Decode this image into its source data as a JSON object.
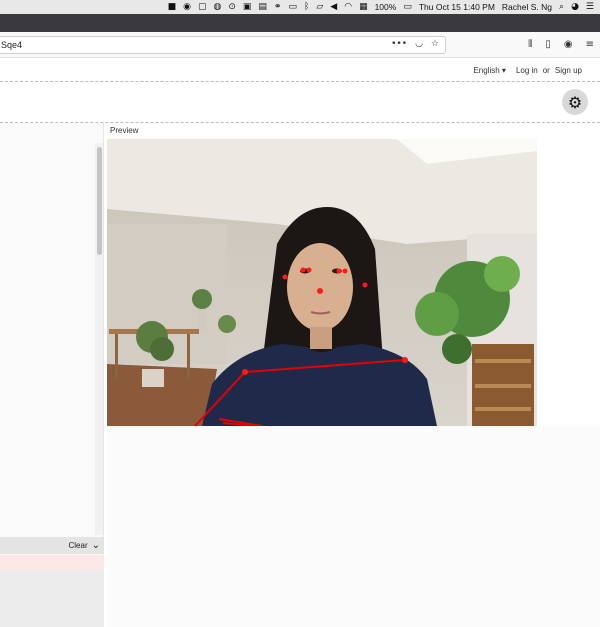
{
  "menubar": {
    "battery": "100%",
    "datetime": "Thu Oct 15  1:40 PM",
    "user": "Rachel S. Ng"
  },
  "browser": {
    "url": "Sqe4"
  },
  "auth": {
    "language": "English",
    "login": "Log in",
    "or": "or",
    "signup": "Sign up"
  },
  "preview": {
    "label": "Preview"
  },
  "console": {
    "clear": "Clear"
  },
  "colors": {
    "keypoint": "#ff1a1a",
    "skeleton": "#e60000"
  }
}
